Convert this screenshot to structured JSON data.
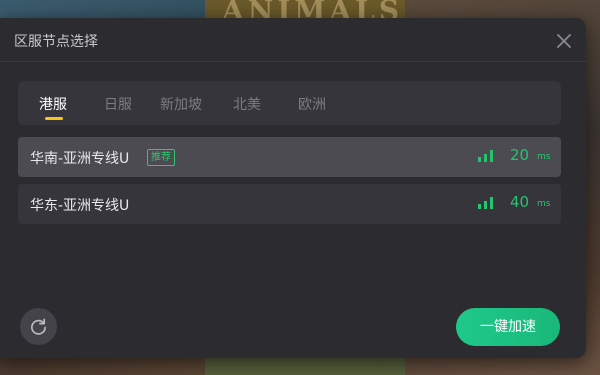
{
  "dialog": {
    "title": "区服节点选择",
    "close_icon": "close-icon"
  },
  "tabs": [
    {
      "label": "港服",
      "active": true
    },
    {
      "label": "日服",
      "active": false
    },
    {
      "label": "新加坡",
      "active": false
    },
    {
      "label": "北美",
      "active": false
    },
    {
      "label": "欧洲",
      "active": false
    }
  ],
  "nodes": [
    {
      "name": "华南-亚洲专线U",
      "badge": "推荐",
      "ping": "20",
      "unit": "ms",
      "signal_icon": "signal-icon",
      "selected": true
    },
    {
      "name": "华东-亚洲专线U",
      "badge": "",
      "ping": "40",
      "unit": "ms",
      "signal_icon": "signal-icon",
      "selected": false
    }
  ],
  "footer": {
    "refresh_icon": "refresh-icon",
    "accelerate_label": "一键加速"
  },
  "background": {
    "poster_text": "ANIMALS"
  },
  "colors": {
    "accent_green": "#26c46e",
    "tab_indicator": "#f5c518",
    "dialog_bg": "#2b2b30"
  }
}
